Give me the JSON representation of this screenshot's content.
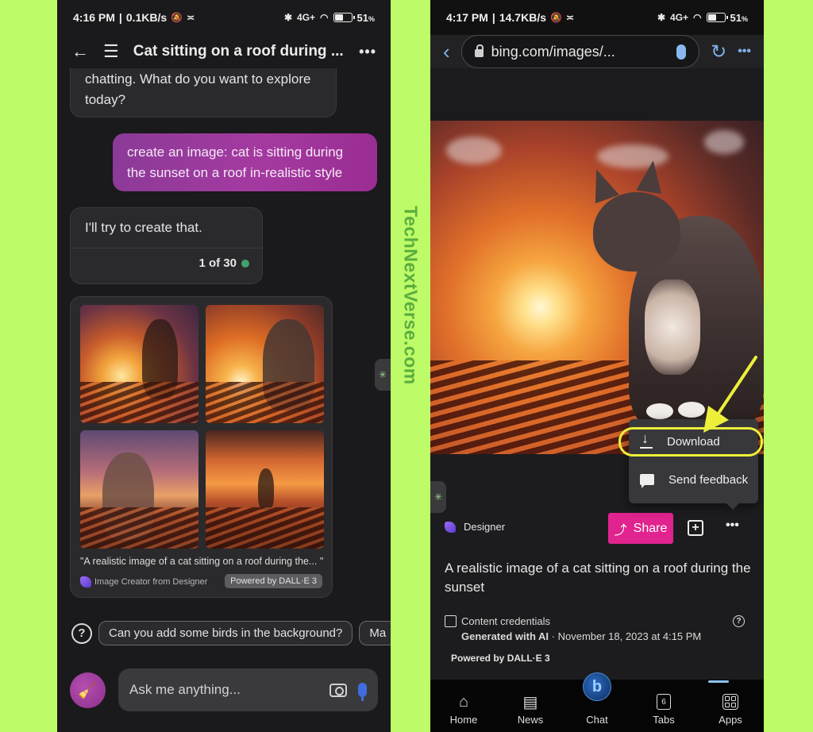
{
  "left": {
    "status": {
      "time": "4:16 PM",
      "speed": "0.1KB/s",
      "battery": "51",
      "net": "4G+"
    },
    "header": {
      "title": "Cat sitting on a roof during ...",
      "back": "←",
      "menu": "☰",
      "more": "•••"
    },
    "messages": {
      "bot_greeting": "chatting. What do you want to explore today?",
      "user_prompt": "create an image: cat is sitting during the sunset on a roof in-realistic style",
      "bot_reply": "I'll try to create that.",
      "counter": "1 of 30"
    },
    "image_card": {
      "images": [
        "cat on roof sunset 1",
        "cat on roof sunset 2",
        "cat on roof sunset 3",
        "cat on roof sunset 4"
      ],
      "caption": "\"A realistic image of a cat sitting on a roof during the... \"",
      "creator": "Image Creator from Designer",
      "powered": "Powered by DALL·E 3"
    },
    "suggestions": [
      "Can you add some birds in the background?",
      "Ma"
    ],
    "input": {
      "placeholder": "Ask me anything..."
    }
  },
  "watermark": "TechNextVerse.com",
  "right": {
    "status": {
      "time": "4:17 PM",
      "speed": "14.7KB/s",
      "battery": "51",
      "net": "4G+"
    },
    "browser": {
      "url": "bing.com/images/...",
      "back": "‹",
      "refresh": "↻",
      "more": "•••"
    },
    "menu": {
      "items": [
        "Download",
        "Send feedback"
      ],
      "highlighted": "Download"
    },
    "actions": {
      "designer": "Designer",
      "share": "Share",
      "more": "•••"
    },
    "description": "A realistic image of a cat sitting on a roof during the sunset",
    "credentials": {
      "label": "Content credentials",
      "generated": "Generated with AI",
      "date": " · November 18, 2023 at 4:15 PM"
    },
    "powered": "Powered by DALL·E 3",
    "nav": [
      {
        "label": "Home",
        "icon": "home-icon"
      },
      {
        "label": "News",
        "icon": "news-icon"
      },
      {
        "label": "Chat",
        "icon": "bing-chat-icon"
      },
      {
        "label": "Tabs",
        "icon": "tabs-icon",
        "count": "6"
      },
      {
        "label": "Apps",
        "icon": "apps-icon",
        "active": true
      }
    ]
  },
  "colors": {
    "background": "#bdfb68",
    "user_bubble": "#9a38a0",
    "share": "#e0238e",
    "highlight": "#ecf03a",
    "accent_blue": "#7fb0e8"
  }
}
